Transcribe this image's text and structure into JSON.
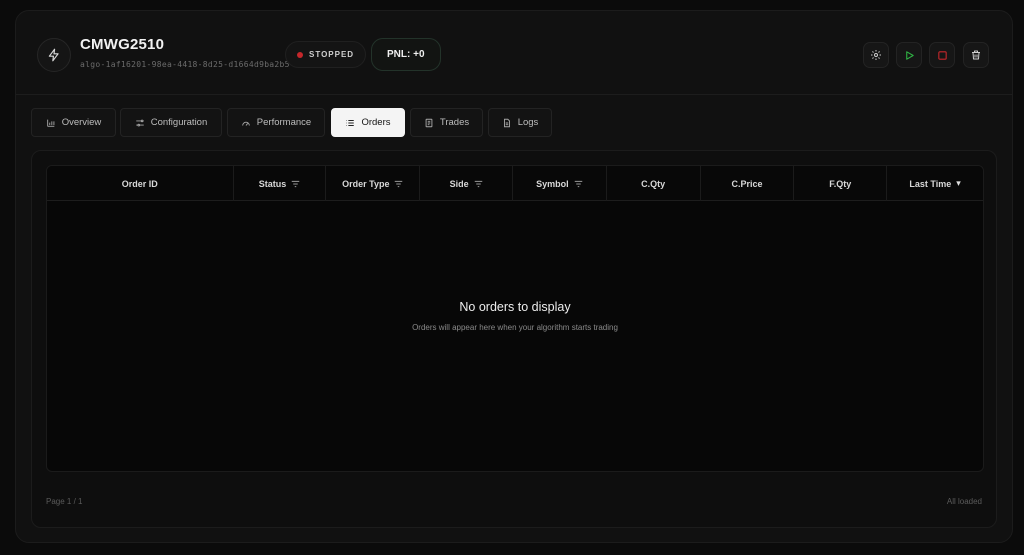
{
  "header": {
    "title": "CMWG2510",
    "subtitle": "algo-1af16201-98ea-4418-8d25-d1664d9ba2b5",
    "status": "STOPPED",
    "pnl": "PNL: +0",
    "icons": [
      "bolt-icon",
      "gear-icon",
      "play-icon",
      "stop-icon",
      "trash-icon"
    ],
    "status_color": "#c5272b",
    "play_color": "#2fb344",
    "stop_color": "#c5272b"
  },
  "tabs": [
    {
      "label": "Overview",
      "icon": "bar-chart-icon"
    },
    {
      "label": "Configuration",
      "icon": "sliders-icon"
    },
    {
      "label": "Performance",
      "icon": "gauge-icon"
    },
    {
      "label": "Orders",
      "icon": "list-icon",
      "active": true
    },
    {
      "label": "Trades",
      "icon": "document-icon"
    },
    {
      "label": "Logs",
      "icon": "file-icon"
    }
  ],
  "table": {
    "columns": [
      "Order ID",
      "Status",
      "Order Type",
      "Side",
      "Symbol",
      "C.Qty",
      "C.Price",
      "F.Qty",
      "Last Time"
    ],
    "sort_indicator": "▾",
    "empty_title": "No orders to display",
    "empty_subtitle": "Orders will appear here when your algorithm starts trading"
  },
  "footer": {
    "page": "Page 1 / 1",
    "status": "All loaded"
  }
}
